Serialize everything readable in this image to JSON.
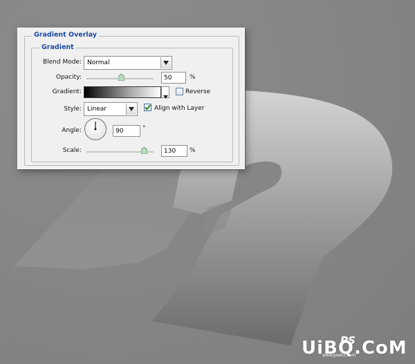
{
  "dialog": {
    "section_title": "Gradient Overlay",
    "group_title": "Gradient",
    "blend_mode": {
      "label": "Blend Mode:",
      "value": "Normal"
    },
    "opacity": {
      "label": "Opacity:",
      "value": "50",
      "unit": "%",
      "level": 0.5
    },
    "gradient": {
      "label": "Gradient:"
    },
    "reverse": {
      "label": "Reverse",
      "checked": false
    },
    "style": {
      "label": "Style:",
      "value": "Linear"
    },
    "align_with_layer": {
      "label": "Align with Layer",
      "checked": true
    },
    "angle": {
      "label": "Angle:",
      "value": "90",
      "unit": "°",
      "degrees": 90
    },
    "scale": {
      "label": "Scale:",
      "value": "130",
      "unit": "%",
      "level": 0.87
    }
  },
  "watermark": {
    "brand": "UiBQ.CoM",
    "ps_mark": "PS",
    "site": "www.psahz.com"
  },
  "colors": {
    "panel": "#f0f0f0",
    "title_blue": "#1c4aa0",
    "canvas": "#868686",
    "check_green": "#2a8a1f"
  }
}
